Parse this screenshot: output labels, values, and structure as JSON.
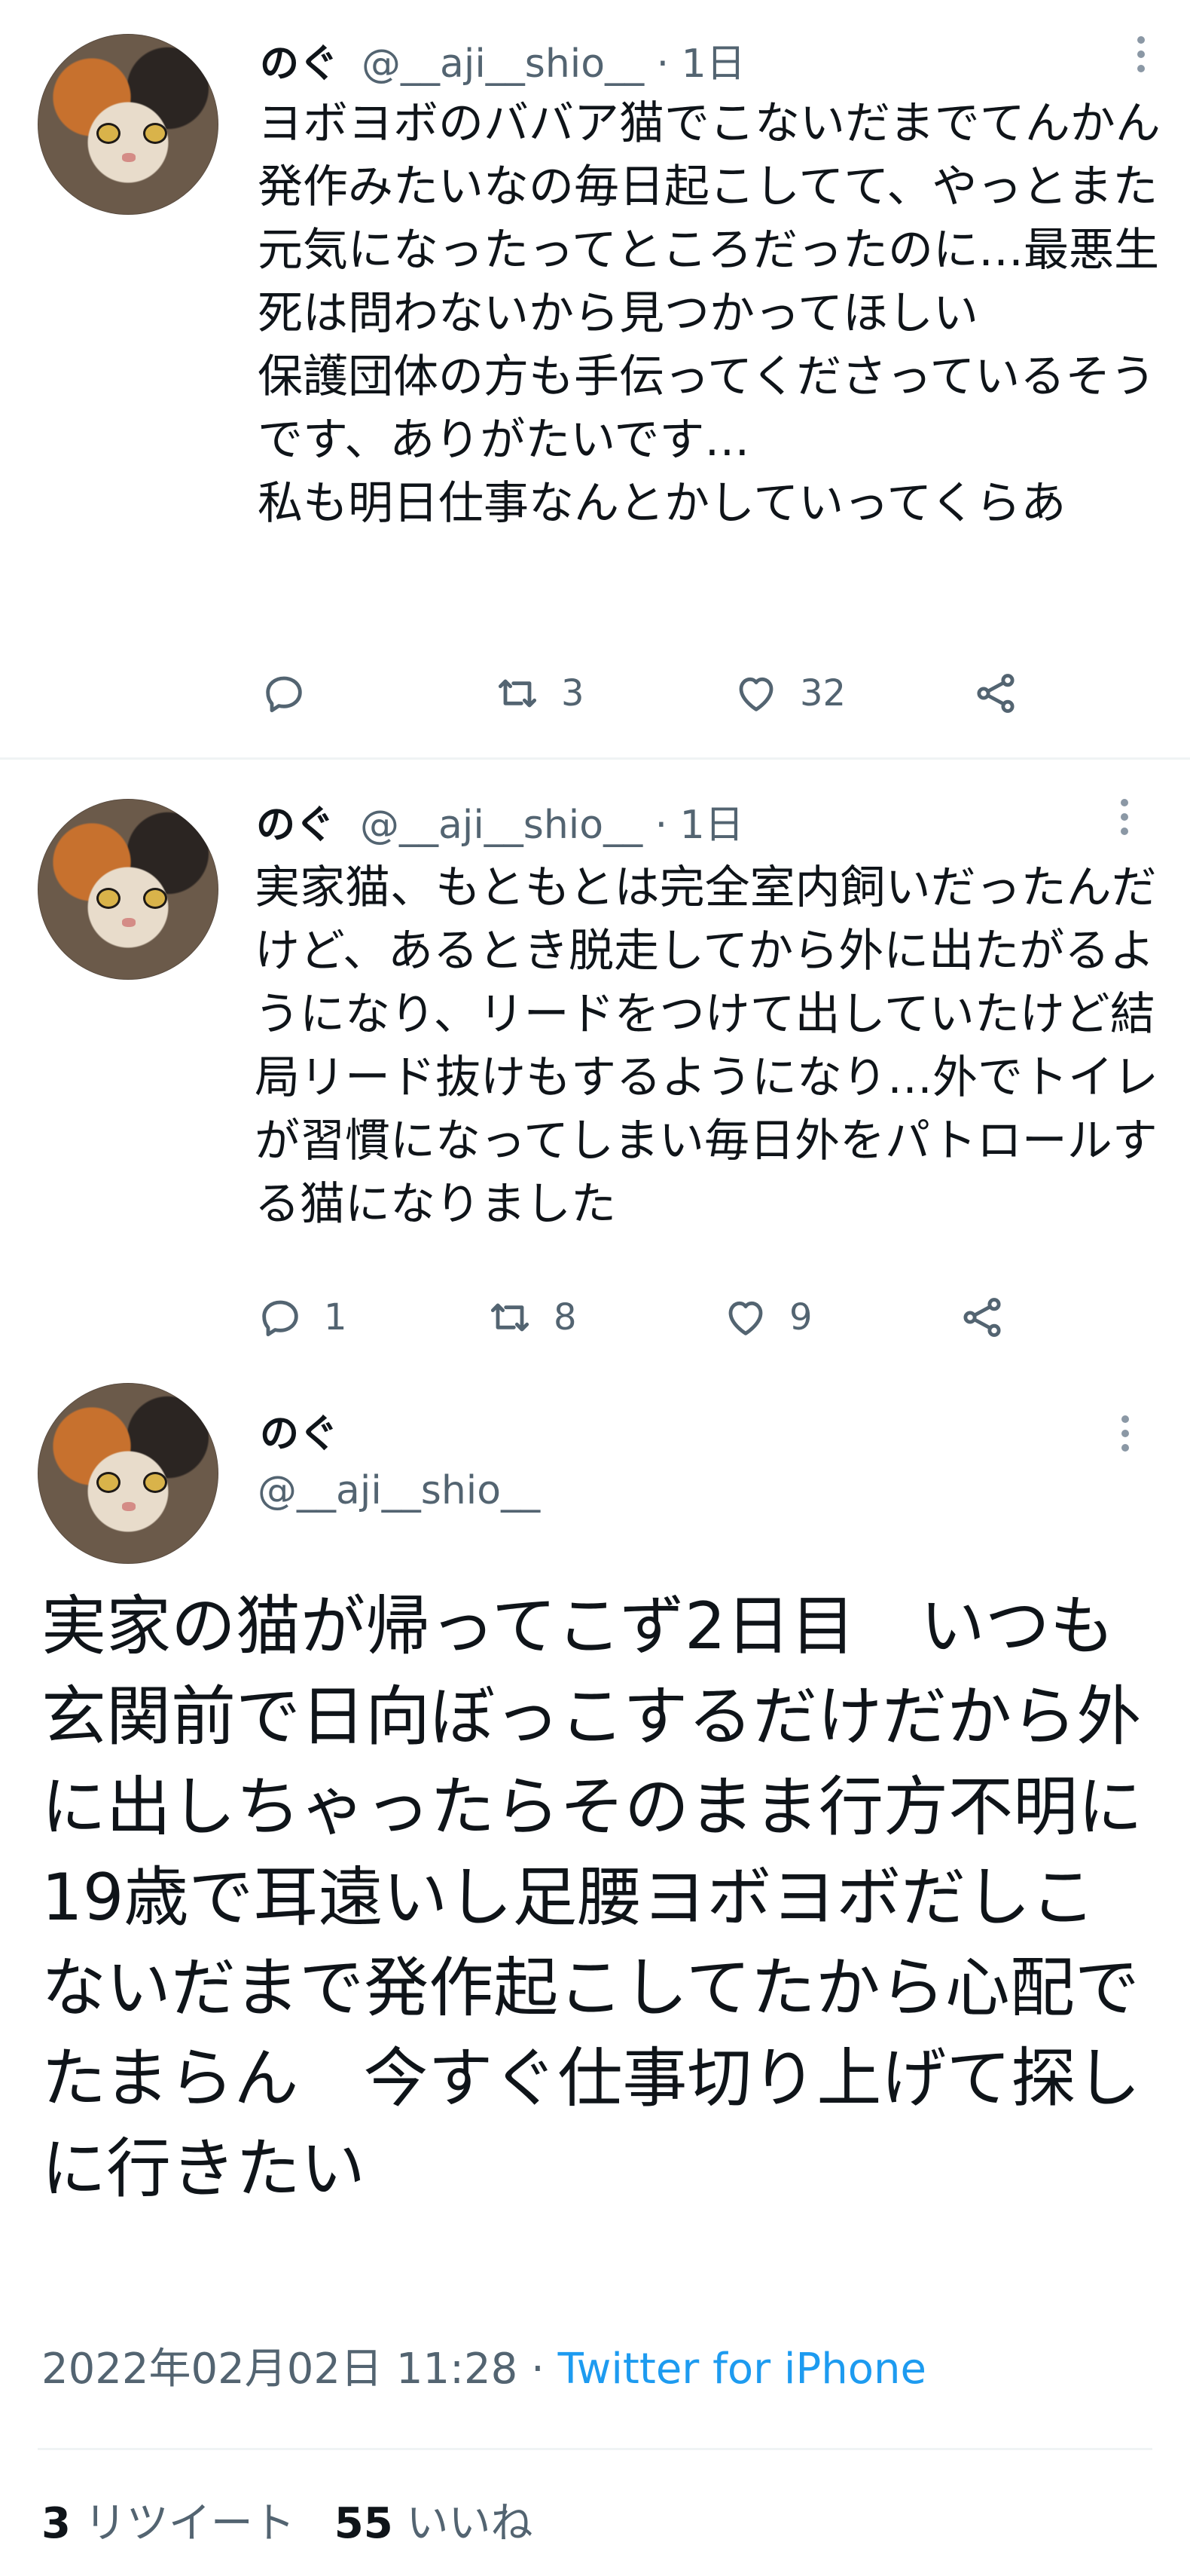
{
  "tweets": [
    {
      "name": "のぐ",
      "handle_line": "@__aji__shio__ · 1日",
      "text": "ヨボヨボのババア猫でこないだまでてんかん発作みたいなの毎日起こしてて、やっとまた元気になったってところだったのに…最悪生死は問わないから見つかってほしい\n保護団体の方も手伝ってくださっているそうです、ありがたいです…\n私も明日仕事なんとかしていってくらあ",
      "reply_count": "",
      "retweet_count": "3",
      "like_count": "32"
    },
    {
      "name": "のぐ",
      "handle_line": "@__aji__shio__ · 1日",
      "text": "実家猫、もともとは完全室内飼いだったんだけど、あるとき脱走してから外に出たがるようになり、リードをつけて出していたけど結局リード抜けもするようになり…外でトイレが習慣になってしまい毎日外をパトロールする猫になりました",
      "reply_count": "1",
      "retweet_count": "8",
      "like_count": "9"
    }
  ],
  "main_tweet": {
    "name": "のぐ",
    "handle": "@__aji__shio__",
    "text": "実家の猫が帰ってこず2日目　いつも玄関前で日向ぼっこするだけだから外に出しちゃったらそのまま行方不明に\n19歳で耳遠いし足腰ヨボヨボだしこないだまで発作起こしてたから心配でたまらん　今すぐ仕事切り上げて探しに行きたい",
    "date": "2022年02月02日 11:28 · ",
    "source": "Twitter for iPhone",
    "retweets_count": "3",
    "retweets_label": " リツイート",
    "likes_count": "55",
    "likes_label": " いいね"
  },
  "colors": {
    "text": "#0f1419",
    "secondary": "#536471",
    "link": "#1d9bf0",
    "divider": "#eff3f4"
  }
}
